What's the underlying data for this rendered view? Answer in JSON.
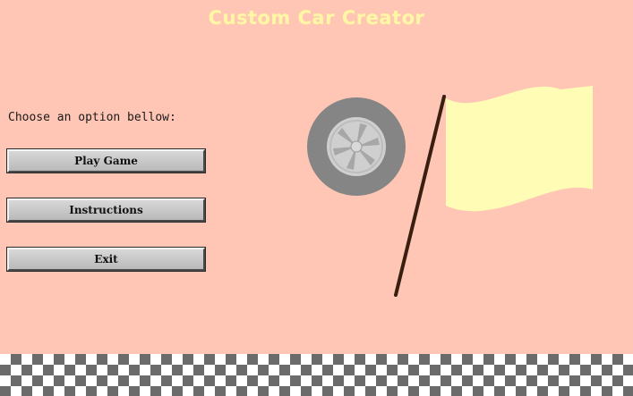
{
  "game": {
    "title": "Custom Car Creator",
    "prompt": "Choose an option bellow:"
  },
  "menu": {
    "buttons": [
      {
        "label": "Play Game"
      },
      {
        "label": "Instructions"
      },
      {
        "label": "Exit"
      }
    ]
  },
  "colors": {
    "background": "#ffc6b5",
    "title": "#fff6a8",
    "flag": "#fffdb5",
    "flag_pole": "#3a1f10",
    "tire": "#858585",
    "hub": "#cfcfcf",
    "checker_dark": "#6b6b6b",
    "checker_light": "#ffffff"
  },
  "icons": {
    "wheel": "car-wheel-icon",
    "flag": "racing-flag-icon",
    "checkered_strip": "checkered-pattern"
  }
}
